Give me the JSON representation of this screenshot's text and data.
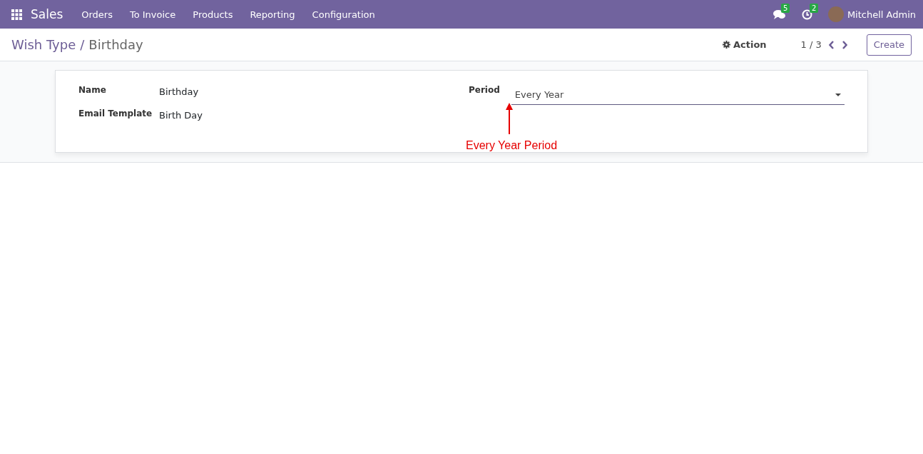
{
  "navbar": {
    "app_name": "Sales",
    "menu": [
      "Orders",
      "To Invoice",
      "Products",
      "Reporting",
      "Configuration"
    ],
    "messages_badge": "5",
    "activities_badge": "2",
    "user_name": "Mitchell Admin"
  },
  "breadcrumb": {
    "parent": "Wish Type",
    "separator": "/",
    "current": "Birthday"
  },
  "control_panel": {
    "action_button": "Action",
    "pager": "1 / 3",
    "create_button": "Create"
  },
  "form": {
    "left_fields": [
      {
        "label": "Name",
        "value": "Birthday"
      },
      {
        "label": "Email Template",
        "value": "Birth Day"
      }
    ],
    "period": {
      "label": "Period",
      "value": "Every Year"
    }
  },
  "annotation": {
    "text": "Every Year Period"
  }
}
